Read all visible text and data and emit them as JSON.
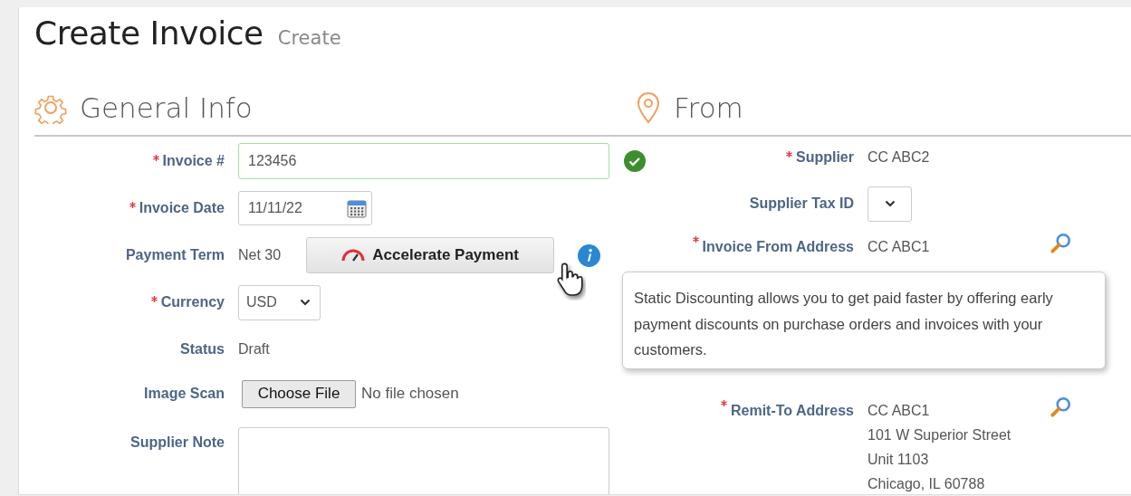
{
  "page": {
    "title": "Create Invoice",
    "subtitle": "Create"
  },
  "sections": [
    {
      "title": "General Info"
    },
    {
      "title": "From"
    }
  ],
  "general_fields": [
    {
      "kind": "input",
      "label": "Invoice #",
      "required": true,
      "value": "123456",
      "valid": true
    },
    {
      "kind": "date",
      "label": "Invoice Date",
      "required": true,
      "value": "11/11/22"
    },
    {
      "kind": "term",
      "label": "Payment Term",
      "required": false,
      "value": "Net 30",
      "button": "Accelerate Payment"
    },
    {
      "kind": "select",
      "label": "Currency",
      "required": true,
      "value": "USD"
    },
    {
      "kind": "text",
      "label": "Status",
      "required": false,
      "value": "Draft"
    },
    {
      "kind": "file",
      "label": "Image Scan",
      "required": false,
      "button": "Choose File",
      "value": "No file chosen"
    },
    {
      "kind": "textarea",
      "label": "Supplier Note",
      "required": false
    }
  ],
  "from_fields": [
    {
      "kind": "text",
      "label": "Supplier",
      "required": true,
      "value": "CC ABC2"
    },
    {
      "kind": "select",
      "label": "Supplier Tax ID",
      "required": false
    },
    {
      "kind": "address",
      "label": "Invoice From Address",
      "required": true,
      "lines": [
        "CC ABC1"
      ]
    },
    {
      "kind": "address",
      "label": "Remit-To Address",
      "required": true,
      "lines": [
        "CC ABC1",
        "101 W Superior Street",
        "Unit 1103",
        "Chicago, IL 60788"
      ]
    }
  ],
  "tooltip": {
    "text": "Static Discounting allows you to get paid faster by offering early payment discounts on purchase orders and invoices with your customers."
  }
}
